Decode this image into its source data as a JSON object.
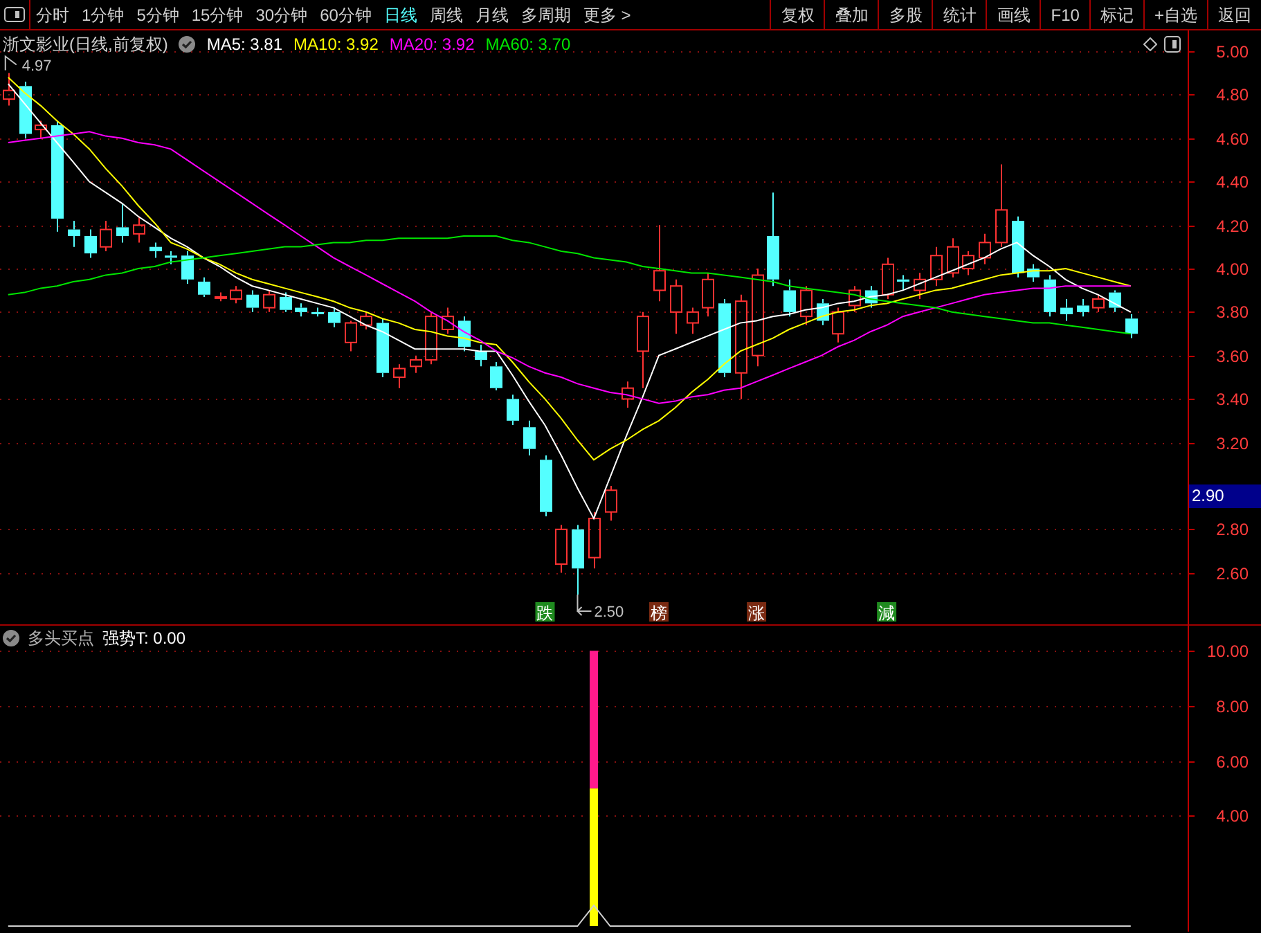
{
  "toolbar": {
    "tabs": [
      {
        "label": "分时",
        "selected": false
      },
      {
        "label": "1分钟",
        "selected": false
      },
      {
        "label": "5分钟",
        "selected": false
      },
      {
        "label": "15分钟",
        "selected": false
      },
      {
        "label": "30分钟",
        "selected": false
      },
      {
        "label": "60分钟",
        "selected": false
      },
      {
        "label": "日线",
        "selected": true
      },
      {
        "label": "周线",
        "selected": false
      },
      {
        "label": "月线",
        "selected": false
      },
      {
        "label": "多周期",
        "selected": false
      },
      {
        "label": "更多 >",
        "selected": false
      }
    ],
    "buttons": [
      "复权",
      "叠加",
      "多股",
      "统计",
      "画线",
      "F10",
      "标记",
      "+自选",
      "返回"
    ]
  },
  "main_panel": {
    "title": "浙文影业(日线,前复权)",
    "legend": [
      {
        "label": "MA5: 3.81",
        "color": "#ffffff"
      },
      {
        "label": "MA10: 3.92",
        "color": "#ffff00"
      },
      {
        "label": "MA20: 3.92",
        "color": "#ff00ff"
      },
      {
        "label": "MA60: 3.70",
        "color": "#00e600"
      }
    ],
    "price_tag": "2.90",
    "signals": [
      {
        "text": "跌",
        "color": "#1f8a1f"
      },
      {
        "text": "榜",
        "color": "#7a2a12"
      },
      {
        "text": "涨",
        "color": "#7a2a12"
      },
      {
        "text": "減",
        "color": "#1f8a1f"
      }
    ],
    "chart_data": {
      "type": "candlestick",
      "grid": true,
      "ylim": [
        2.363,
        5.096
      ],
      "yticks": [
        {
          "value": 5.0,
          "label": "5.00"
        },
        {
          "value": 4.8,
          "label": "4.80"
        },
        {
          "value": 4.6,
          "label": "4.60"
        },
        {
          "value": 4.4,
          "label": "4.40"
        },
        {
          "value": 4.2,
          "label": "4.20"
        },
        {
          "value": 4.0,
          "label": "4.00"
        },
        {
          "value": 3.8,
          "label": "3.80"
        },
        {
          "value": 3.6,
          "label": "3.60"
        },
        {
          "value": 3.4,
          "label": "3.40"
        },
        {
          "value": 3.2,
          "label": "3.20"
        },
        {
          "value": 2.8,
          "label": "2.80"
        },
        {
          "value": 2.6,
          "label": "2.60"
        }
      ],
      "ohlc": [
        [
          4.78,
          4.9,
          4.75,
          4.82
        ],
        [
          4.84,
          4.86,
          4.6,
          4.62
        ],
        [
          4.64,
          4.68,
          4.6,
          4.66
        ],
        [
          4.66,
          4.68,
          4.17,
          4.23
        ],
        [
          4.18,
          4.22,
          4.1,
          4.15
        ],
        [
          4.15,
          4.18,
          4.05,
          4.07
        ],
        [
          4.1,
          4.22,
          4.08,
          4.18
        ],
        [
          4.19,
          4.3,
          4.12,
          4.15
        ],
        [
          4.16,
          4.24,
          4.12,
          4.2
        ],
        [
          4.1,
          4.12,
          4.05,
          4.08
        ],
        [
          4.06,
          4.08,
          4.02,
          4.05
        ],
        [
          4.06,
          4.08,
          3.93,
          3.95
        ],
        [
          3.94,
          3.96,
          3.87,
          3.88
        ],
        [
          3.87,
          3.89,
          3.85,
          3.87
        ],
        [
          3.86,
          3.92,
          3.84,
          3.9
        ],
        [
          3.88,
          3.9,
          3.8,
          3.82
        ],
        [
          3.82,
          3.9,
          3.8,
          3.88
        ],
        [
          3.87,
          3.89,
          3.8,
          3.81
        ],
        [
          3.82,
          3.84,
          3.78,
          3.8
        ],
        [
          3.8,
          3.82,
          3.78,
          3.79
        ],
        [
          3.8,
          3.82,
          3.73,
          3.75
        ],
        [
          3.66,
          3.76,
          3.62,
          3.75
        ],
        [
          3.74,
          3.8,
          3.72,
          3.78
        ],
        [
          3.75,
          3.77,
          3.5,
          3.52
        ],
        [
          3.5,
          3.56,
          3.45,
          3.54
        ],
        [
          3.55,
          3.6,
          3.52,
          3.58
        ],
        [
          3.58,
          3.8,
          3.56,
          3.78
        ],
        [
          3.72,
          3.82,
          3.7,
          3.78
        ],
        [
          3.76,
          3.78,
          3.62,
          3.64
        ],
        [
          3.62,
          3.65,
          3.55,
          3.58
        ],
        [
          3.55,
          3.57,
          3.44,
          3.45
        ],
        [
          3.4,
          3.42,
          3.28,
          3.3
        ],
        [
          3.27,
          3.3,
          3.14,
          3.17
        ],
        [
          3.12,
          3.14,
          2.86,
          2.88
        ],
        [
          2.64,
          2.82,
          2.6,
          2.8
        ],
        [
          2.8,
          2.82,
          2.5,
          2.62
        ],
        [
          2.67,
          2.88,
          2.62,
          2.85
        ],
        [
          2.88,
          3.0,
          2.84,
          2.98
        ],
        [
          3.4,
          3.48,
          3.36,
          3.45
        ],
        [
          3.62,
          3.8,
          3.45,
          3.78
        ],
        [
          3.9,
          4.2,
          3.85,
          3.99
        ],
        [
          3.8,
          3.95,
          3.7,
          3.92
        ],
        [
          3.75,
          3.82,
          3.7,
          3.8
        ],
        [
          3.82,
          3.98,
          3.78,
          3.95
        ],
        [
          3.84,
          3.86,
          3.5,
          3.52
        ],
        [
          3.52,
          3.88,
          3.4,
          3.85
        ],
        [
          3.6,
          4.0,
          3.55,
          3.97
        ],
        [
          4.15,
          4.35,
          3.92,
          3.95
        ],
        [
          3.9,
          3.95,
          3.78,
          3.8
        ],
        [
          3.78,
          3.92,
          3.74,
          3.9
        ],
        [
          3.84,
          3.86,
          3.74,
          3.76
        ],
        [
          3.7,
          3.82,
          3.66,
          3.8
        ],
        [
          3.83,
          3.92,
          3.8,
          3.9
        ],
        [
          3.9,
          3.92,
          3.82,
          3.84
        ],
        [
          3.88,
          4.05,
          3.86,
          4.02
        ],
        [
          3.95,
          3.97,
          3.9,
          3.94
        ],
        [
          3.9,
          3.98,
          3.86,
          3.95
        ],
        [
          3.95,
          4.1,
          3.92,
          4.06
        ],
        [
          3.98,
          4.14,
          3.96,
          4.1
        ],
        [
          4.0,
          4.08,
          3.97,
          4.06
        ],
        [
          4.05,
          4.16,
          4.02,
          4.12
        ],
        [
          4.12,
          4.48,
          4.1,
          4.27
        ],
        [
          4.22,
          4.24,
          3.96,
          3.98
        ],
        [
          4.0,
          4.02,
          3.94,
          3.96
        ],
        [
          3.95,
          3.97,
          3.78,
          3.8
        ],
        [
          3.82,
          3.86,
          3.76,
          3.79
        ],
        [
          3.83,
          3.86,
          3.78,
          3.8
        ],
        [
          3.82,
          3.88,
          3.8,
          3.86
        ],
        [
          3.89,
          3.9,
          3.8,
          3.82
        ],
        [
          3.77,
          3.79,
          3.68,
          3.7
        ],
        null,
        null,
        null
      ],
      "series": [
        {
          "type": "line",
          "color": "#ffffff",
          "values": [
            4.85,
            4.76,
            4.67,
            4.58,
            4.49,
            4.4,
            4.35,
            4.3,
            4.24,
            4.19,
            4.14,
            4.1,
            4.05,
            4.01,
            3.96,
            3.92,
            3.9,
            3.88,
            3.86,
            3.84,
            3.82,
            3.78,
            3.74,
            3.71,
            3.67,
            3.63,
            3.63,
            3.63,
            3.63,
            3.62,
            3.62,
            3.51,
            3.39,
            3.28,
            3.14,
            2.99,
            2.85,
            3.04,
            3.23,
            3.41,
            3.6,
            3.63,
            3.66,
            3.69,
            3.72,
            3.75,
            3.76,
            3.78,
            3.79,
            3.81,
            3.82,
            3.84,
            3.85,
            3.87,
            3.88,
            3.9,
            3.93,
            3.96,
            3.99,
            4.02,
            4.05,
            4.09,
            4.12,
            4.06,
            4.01,
            3.95,
            3.91,
            3.88,
            3.84,
            3.8,
            null,
            null,
            null
          ]
        },
        {
          "type": "line",
          "color": "#ffff00",
          "values": [
            4.88,
            4.81,
            4.75,
            4.68,
            4.62,
            4.55,
            4.46,
            4.38,
            4.29,
            4.21,
            4.12,
            4.09,
            4.05,
            4.02,
            3.98,
            3.95,
            3.93,
            3.91,
            3.89,
            3.87,
            3.85,
            3.82,
            3.8,
            3.77,
            3.75,
            3.72,
            3.71,
            3.69,
            3.68,
            3.66,
            3.65,
            3.57,
            3.48,
            3.4,
            3.31,
            3.21,
            3.12,
            3.17,
            3.21,
            3.26,
            3.3,
            3.36,
            3.43,
            3.49,
            3.56,
            3.62,
            3.65,
            3.68,
            3.72,
            3.75,
            3.78,
            3.8,
            3.81,
            3.83,
            3.84,
            3.86,
            3.88,
            3.9,
            3.91,
            3.93,
            3.95,
            3.97,
            3.98,
            3.99,
            3.99,
            4.0,
            3.98,
            3.96,
            3.94,
            3.92,
            null,
            null,
            null
          ]
        },
        {
          "type": "line",
          "color": "#ff00ff",
          "values": [
            4.58,
            4.59,
            4.6,
            4.61,
            4.62,
            4.63,
            4.61,
            4.6,
            4.58,
            4.57,
            4.55,
            4.5,
            4.45,
            4.4,
            4.35,
            4.3,
            4.25,
            4.2,
            4.15,
            4.1,
            4.05,
            4.01,
            3.97,
            3.93,
            3.89,
            3.85,
            3.8,
            3.76,
            3.71,
            3.67,
            3.62,
            3.59,
            3.55,
            3.52,
            3.5,
            3.47,
            3.45,
            3.43,
            3.42,
            3.4,
            3.38,
            3.39,
            3.41,
            3.42,
            3.44,
            3.45,
            3.48,
            3.51,
            3.54,
            3.57,
            3.6,
            3.64,
            3.67,
            3.71,
            3.74,
            3.78,
            3.8,
            3.82,
            3.84,
            3.86,
            3.88,
            3.89,
            3.9,
            3.91,
            3.91,
            3.92,
            3.92,
            3.92,
            3.92,
            3.92,
            null,
            null,
            null
          ]
        },
        {
          "type": "line",
          "color": "#00e600",
          "values": [
            3.88,
            3.89,
            3.91,
            3.92,
            3.94,
            3.95,
            3.97,
            3.98,
            4.0,
            4.01,
            4.03,
            4.04,
            4.05,
            4.06,
            4.07,
            4.08,
            4.09,
            4.1,
            4.1,
            4.11,
            4.12,
            4.12,
            4.13,
            4.13,
            4.14,
            4.14,
            4.14,
            4.14,
            4.15,
            4.15,
            4.15,
            4.13,
            4.12,
            4.1,
            4.08,
            4.07,
            4.05,
            4.04,
            4.03,
            4.01,
            4.0,
            3.99,
            3.98,
            3.98,
            3.97,
            3.96,
            3.95,
            3.94,
            3.92,
            3.91,
            3.9,
            3.89,
            3.88,
            3.86,
            3.85,
            3.84,
            3.83,
            3.82,
            3.8,
            3.79,
            3.78,
            3.77,
            3.76,
            3.75,
            3.75,
            3.74,
            3.73,
            3.72,
            3.71,
            3.7,
            null,
            null,
            null
          ]
        }
      ],
      "annotations": [
        "4.97",
        "2.50"
      ]
    }
  },
  "lower_panel": {
    "title": "多头买点",
    "reading": "强势T: 0.00",
    "chart_data": {
      "type": "bar",
      "stacked": true,
      "grid": true,
      "ylim": [
        -0.2,
        10.96
      ],
      "yticks": [
        {
          "value": 10,
          "label": "10.00"
        },
        {
          "value": 8,
          "label": "8.00"
        },
        {
          "value": 6,
          "label": "6.00"
        },
        {
          "value": 4,
          "label": "4.00"
        }
      ],
      "series": [
        {
          "color": "#ffff00",
          "values": [
            null,
            null,
            null,
            null,
            null,
            null,
            null,
            null,
            null,
            null,
            null,
            null,
            null,
            null,
            null,
            null,
            null,
            null,
            null,
            null,
            null,
            null,
            null,
            null,
            null,
            null,
            null,
            null,
            null,
            null,
            null,
            null,
            null,
            null,
            null,
            null,
            5,
            null,
            null,
            null,
            null,
            null,
            null,
            null,
            null,
            null,
            null,
            null,
            null,
            null,
            null,
            null,
            null,
            null,
            null,
            null,
            null,
            null,
            null,
            null,
            null,
            null,
            null,
            null,
            null,
            null,
            null,
            null,
            null,
            null,
            null,
            null,
            null
          ]
        },
        {
          "color": "#ff1a8c",
          "values": [
            null,
            null,
            null,
            null,
            null,
            null,
            null,
            null,
            null,
            null,
            null,
            null,
            null,
            null,
            null,
            null,
            null,
            null,
            null,
            null,
            null,
            null,
            null,
            null,
            null,
            null,
            null,
            null,
            null,
            null,
            null,
            null,
            null,
            null,
            null,
            null,
            5,
            null,
            null,
            null,
            null,
            null,
            null,
            null,
            null,
            null,
            null,
            null,
            null,
            null,
            null,
            null,
            null,
            null,
            null,
            null,
            null,
            null,
            null,
            null,
            null,
            null,
            null,
            null,
            null,
            null,
            null,
            null,
            null,
            null,
            null,
            null,
            null
          ]
        },
        {
          "type": "line",
          "color": "#d0d0d0",
          "values": [
            0,
            0,
            0,
            0,
            0,
            0,
            0,
            0,
            0,
            0,
            0,
            0,
            0,
            0,
            0,
            0,
            0,
            0,
            0,
            0,
            0,
            0,
            0,
            0,
            0,
            0,
            0,
            0,
            0,
            0,
            0,
            0,
            0,
            0,
            0,
            0,
            0.75,
            0,
            0,
            0,
            0,
            0,
            0,
            0,
            0,
            0,
            0,
            0,
            0,
            0,
            0,
            0,
            0,
            0,
            0,
            0,
            0,
            0,
            0,
            0,
            0,
            0,
            0,
            0,
            0,
            0,
            0,
            0,
            0,
            0,
            null,
            null,
            null
          ]
        }
      ]
    }
  }
}
